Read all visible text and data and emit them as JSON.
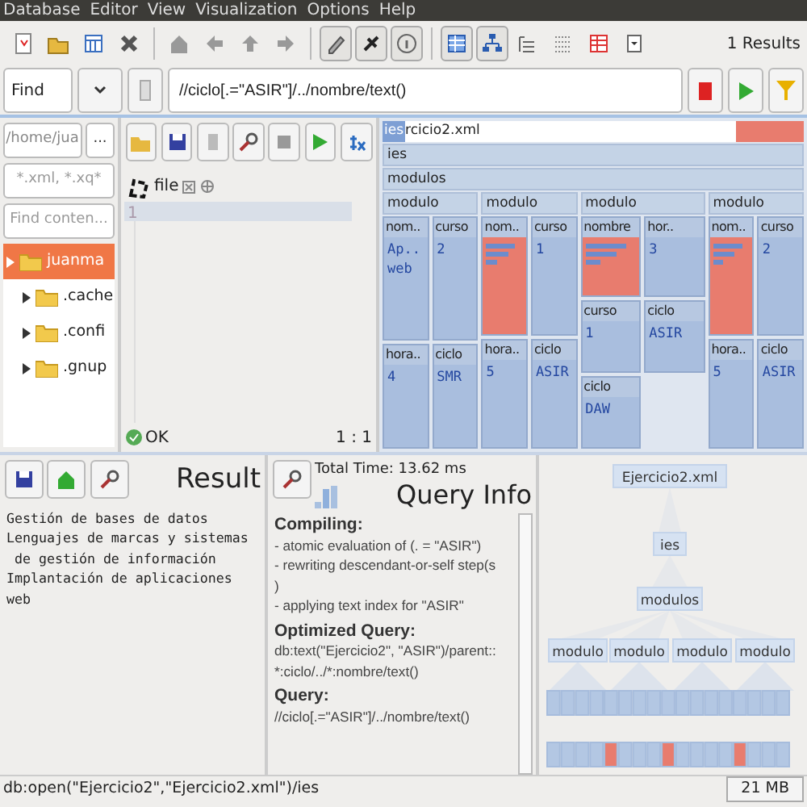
{
  "menu": [
    "Database",
    "Editor",
    "View",
    "Visualization",
    "Options",
    "Help"
  ],
  "toolbar": [
    {
      "pressed": false
    },
    {
      "pressed": false
    },
    {
      "pressed": false
    },
    {
      "pressed": false
    },
    {
      "pressed": false
    },
    {
      "pressed": false
    },
    {
      "pressed": false
    },
    {
      "pressed": false
    },
    {
      "pressed": true
    },
    {
      "pressed": true
    },
    {
      "pressed": true
    },
    {
      "pressed": true
    },
    {
      "pressed": true
    },
    {
      "pressed": false
    },
    {
      "pressed": false
    },
    {
      "pressed": false
    },
    {
      "pressed": false
    }
  ],
  "results": "1 Results",
  "find": {
    "mode": "Find",
    "query": "//ciclo[.=\"ASIR\"]/../nombre/text()"
  },
  "file_browser": {
    "path": "/home/jua",
    "browse": "...",
    "filter": "*.xml, *.xq*",
    "search_placeholder": "Find conten...",
    "tree": [
      {
        "label": "juanma",
        "selected": true,
        "children": [
          {
            "label": ".cache",
            "selected": false
          },
          {
            "label": ".confi",
            "selected": false
          },
          {
            "label": ".gnup",
            "selected": false
          }
        ]
      }
    ]
  },
  "editor": {
    "tab": "file",
    "line": "1",
    "status": "OK",
    "position": "1 : 1"
  },
  "map": {
    "title": "rcicio2.xml",
    "tooltip": "ies",
    "root": "ies",
    "child": "modulos",
    "modules": [
      {
        "label": "modulo",
        "cells": [
          {
            "label": "nom..",
            "value": "Ap.. web",
            "highlighted": false
          },
          {
            "label": "curso",
            "value": "2",
            "highlighted": false
          },
          {
            "label": "hora..",
            "value": "4",
            "highlighted": false
          },
          {
            "label": "ciclo",
            "value": "SMR",
            "highlighted": false
          }
        ]
      },
      {
        "label": "modulo",
        "cells": [
          {
            "label": "nom..",
            "highlighted": true
          },
          {
            "label": "curso",
            "value": "1",
            "highlighted": false
          },
          {
            "label": "hora..",
            "value": "5",
            "highlighted": false
          },
          {
            "label": "ciclo",
            "value": "ASIR",
            "highlighted": false
          }
        ]
      },
      {
        "label": "modulo",
        "cells": [
          {
            "label": "nombre",
            "highlighted": true
          },
          {
            "label": "hor..",
            "value": "3",
            "highlighted": false
          },
          {
            "label": "curso",
            "value": "1",
            "highlighted": false
          },
          {
            "label": "ciclo",
            "value": "ASIR",
            "highlighted": false
          },
          {
            "label": "ciclo",
            "value": "DAW",
            "highlighted": false
          }
        ]
      },
      {
        "label": "modulo",
        "cells": [
          {
            "label": "nom..",
            "highlighted": true
          },
          {
            "label": "curso",
            "value": "2",
            "highlighted": false
          },
          {
            "label": "hora..",
            "value": "5",
            "highlighted": false
          },
          {
            "label": "ciclo",
            "value": "ASIR",
            "highlighted": false
          }
        ]
      }
    ]
  },
  "result": {
    "title": "Result",
    "lines": [
      "Gestión de bases de datos",
      "Lenguajes de marcas y sistemas",
      " de gestión de información",
      "Implantación de aplicaciones",
      "web"
    ]
  },
  "query_info": {
    "total_time": "Total Time: 13.62 ms",
    "title": "Query Info",
    "sections": [
      {
        "heading": "Compiling:",
        "lines": [
          "- atomic evaluation of (. = \"ASIR\")",
          "- rewriting descendant-or-self step(s",
          ")",
          "- applying text index for \"ASIR\""
        ]
      },
      {
        "heading": "Optimized Query:",
        "lines": [
          "db:text(\"Ejercicio2\", \"ASIR\")/parent::",
          "*:ciclo/../*:nombre/text()"
        ]
      },
      {
        "heading": "Query:",
        "lines": [
          "//ciclo[.=\"ASIR\"]/../nombre/text()"
        ]
      }
    ]
  },
  "tree": {
    "root": "Ejercicio2.xml",
    "level1": "ies",
    "level2": "modulos",
    "modules": [
      "modulo",
      "modulo",
      "modulo",
      "modulo"
    ],
    "leaves": [
      {
        "highlighted": false
      },
      {
        "highlighted": false
      },
      {
        "highlighted": false
      },
      {
        "highlighted": false
      },
      {
        "highlighted": true
      },
      {
        "highlighted": false
      },
      {
        "highlighted": false
      },
      {
        "highlighted": false
      },
      {
        "highlighted": true
      },
      {
        "highlighted": false
      },
      {
        "highlighted": false
      },
      {
        "highlighted": false
      },
      {
        "highlighted": false
      },
      {
        "highlighted": true
      },
      {
        "highlighted": false
      },
      {
        "highlighted": false
      },
      {
        "highlighted": false
      }
    ]
  },
  "status_bar": {
    "text": "db:open(\"Ejercicio2\",\"Ejercicio2.xml\")/ies",
    "memory": "21 MB"
  }
}
